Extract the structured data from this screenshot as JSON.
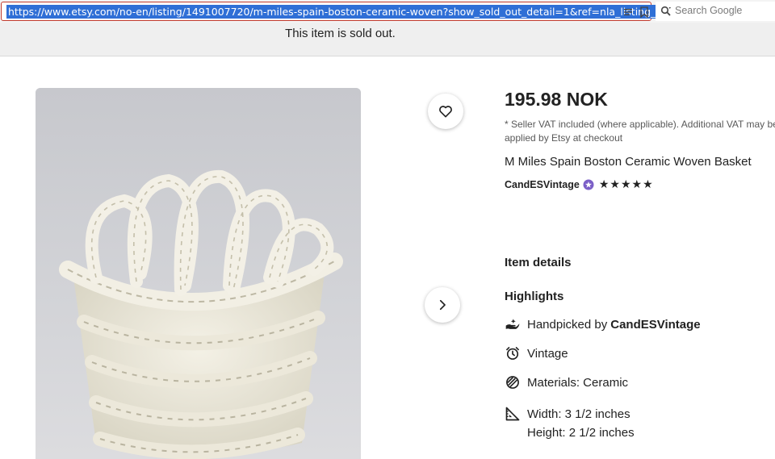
{
  "browser": {
    "url": "https://www.etsy.com/no-en/listing/1491007720/m-miles-spain-boston-ceramic-woven?show_sold_out_detail=1&ref=nla_listing_details",
    "search_placeholder": "Search Google"
  },
  "banner": {
    "text": "This item is sold out."
  },
  "product": {
    "price": "195.98 NOK",
    "vat_note": "* Seller VAT included (where applicable). Additional VAT may be applied by Etsy at checkout",
    "title": "M Miles Spain Boston Ceramic Woven Basket",
    "shop": "CandESVintage",
    "stars": "★★★★★",
    "rating": 5
  },
  "details": {
    "heading": "Item details",
    "highlights_heading": "Highlights",
    "handpicked_prefix": "Handpicked by",
    "handpicked_shop": "CandESVintage",
    "vintage": "Vintage",
    "materials": "Materials: Ceramic",
    "width": "Width: 3 1/2 inches",
    "height": "Height: 2 1/2 inches"
  },
  "icons": {
    "favorite": "heart-icon",
    "next": "chevron-right-icon",
    "reader": "reader-view-icon",
    "bookmark": "bookmark-icon",
    "search": "search-icon",
    "star_seller": "star-seller-badge-icon",
    "handpicked": "hand-icon",
    "vintage": "alarm-clock-icon",
    "materials": "materials-icon",
    "dimensions": "ruler-triangle-icon"
  },
  "colors": {
    "url_highlight": "#2f6fd6",
    "url_border": "#c0392b",
    "star_seller": "#7b5fc7"
  }
}
